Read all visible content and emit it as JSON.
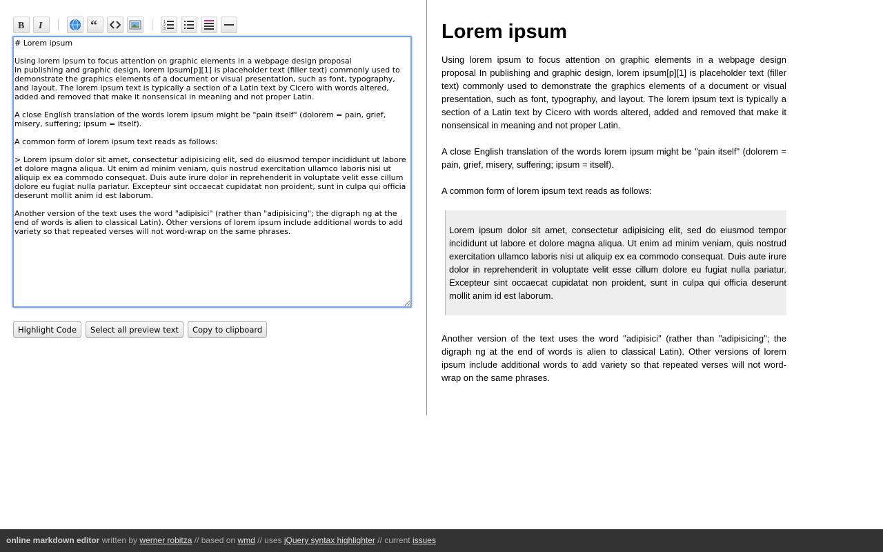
{
  "toolbar": {
    "buttons": [
      "bold-icon",
      "italic-icon",
      "link-icon",
      "quote-icon",
      "code-icon",
      "image-icon",
      "numbered-list-icon",
      "bullet-list-icon",
      "heading-icon",
      "horizontal-rule-icon"
    ]
  },
  "editor": {
    "value": "# Lorem ipsum\n\nUsing lorem ipsum to focus attention on graphic elements in a webpage design proposal\nIn publishing and graphic design, lorem ipsum[p][1] is placeholder text (filler text) commonly used to demonstrate the graphics elements of a document or visual presentation, such as font, typography, and layout. The lorem ipsum text is typically a section of a Latin text by Cicero with words altered, added and removed that make it nonsensical in meaning and not proper Latin.\n\nA close English translation of the words lorem ipsum might be \"pain itself\" (dolorem = pain, grief, misery, suffering; ipsum = itself).\n\nA common form of lorem ipsum text reads as follows:\n\n> Lorem ipsum dolor sit amet, consectetur adipisicing elit, sed do eiusmod tempor incididunt ut labore et dolore magna aliqua. Ut enim ad minim veniam, quis nostrud exercitation ullamco laboris nisi ut aliquip ex ea commodo consequat. Duis aute irure dolor in reprehenderit in voluptate velit esse cillum dolore eu fugiat nulla pariatur. Excepteur sint occaecat cupidatat non proident, sunt in culpa qui officia deserunt mollit anim id est laborum.\n\nAnother version of the text uses the word \"adipisici\" (rather than \"adipisicing\"; the digraph ng at the end of words is alien to classical Latin). Other versions of lorem ipsum include additional words to add variety so that repeated verses will not word-wrap on the same phrases."
  },
  "buttons": {
    "highlight": "Highlight Code",
    "select_all": "Select all preview text",
    "copy": "Copy to clipboard"
  },
  "preview": {
    "title": "Lorem ipsum",
    "p1": "Using lorem ipsum to focus attention on graphic elements in a webpage design proposal In publishing and graphic design, lorem ipsum[p][1] is placeholder text (filler text) commonly used to demonstrate the graphics elements of a document or visual presentation, such as font, typography, and layout. The lorem ipsum text is typically a section of a Latin text by Cicero with words altered, added and removed that make it nonsensical in meaning and not proper Latin.",
    "p2": "A close English translation of the words lorem ipsum might be \"pain itself\" (dolorem = pain, grief, misery, suffering; ipsum = itself).",
    "p3": "A common form of lorem ipsum text reads as follows:",
    "quote": "Lorem ipsum dolor sit amet, consectetur adipisicing elit, sed do eiusmod tempor incididunt ut labore et dolore magna aliqua. Ut enim ad minim veniam, quis nostrud exercitation ullamco laboris nisi ut aliquip ex ea commodo consequat. Duis aute irure dolor in reprehenderit in voluptate velit esse cillum dolore eu fugiat nulla pariatur. Excepteur sint occaecat cupidatat non proident, sunt in culpa qui officia deserunt mollit anim id est laborum.",
    "p4": "Another version of the text uses the word \"adipisici\" (rather than \"adipisicing\"; the digraph ng at the end of words is alien to classical Latin). Other versions of lorem ipsum include additional words to add variety so that repeated verses will not word-wrap on the same phrases."
  },
  "footer": {
    "brand": "online markdown editor",
    "written_by": " written by ",
    "author": "werner robitza",
    "based_on": " // based on ",
    "wmd": "wmd",
    "uses": " // uses ",
    "jquery": "jQuery syntax highlighter",
    "current": " // current ",
    "issues": "issues"
  }
}
